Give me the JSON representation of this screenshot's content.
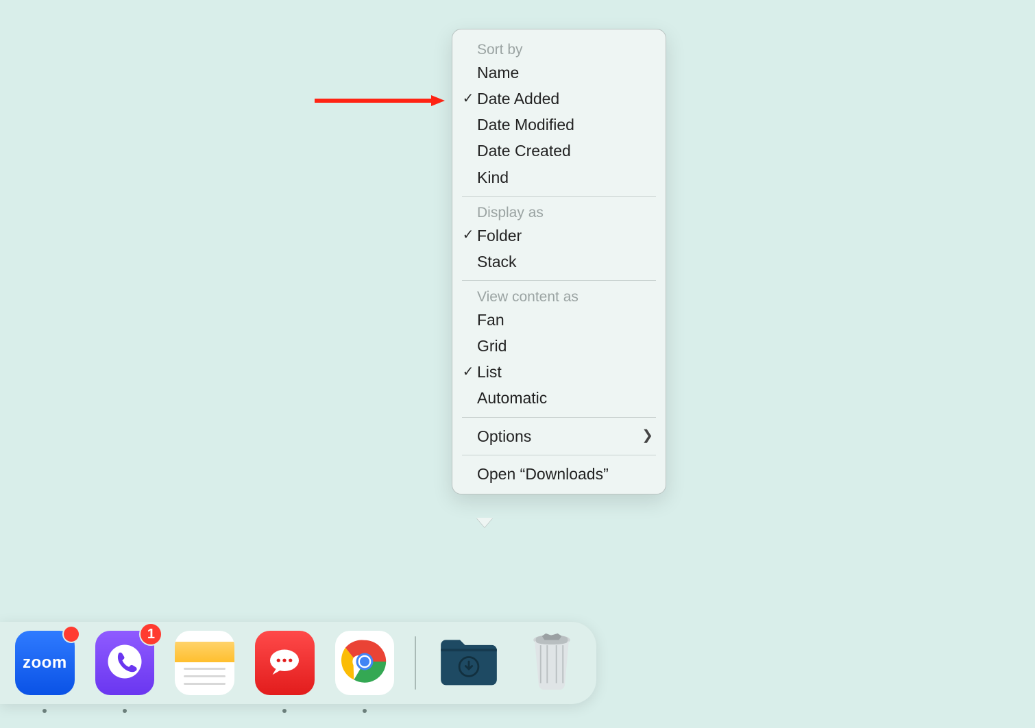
{
  "annotation": {
    "arrow_color": "#ff2414"
  },
  "menu": {
    "sort_by": {
      "label": "Sort by",
      "options": [
        "Name",
        "Date Added",
        "Date Modified",
        "Date Created",
        "Kind"
      ],
      "selected": "Date Added"
    },
    "display_as": {
      "label": "Display as",
      "options": [
        "Folder",
        "Stack"
      ],
      "selected": "Folder"
    },
    "view_as": {
      "label": "View content as",
      "options": [
        "Fan",
        "Grid",
        "List",
        "Automatic"
      ],
      "selected": "List"
    },
    "options_label": "Options",
    "open_label": "Open “Downloads”"
  },
  "dock": {
    "apps": [
      {
        "id": "zoom",
        "label": "zoom",
        "badge": "",
        "running": true
      },
      {
        "id": "viber",
        "label": "Viber",
        "badge": "1",
        "running": true
      },
      {
        "id": "notes",
        "label": "Notes",
        "badge": null,
        "running": true
      },
      {
        "id": "rocket",
        "label": "Rocket.Chat",
        "badge": null,
        "running": true
      },
      {
        "id": "chrome",
        "label": "Google Chrome",
        "badge": null,
        "running": true
      }
    ],
    "stacks": [
      {
        "id": "downloads",
        "label": "Downloads"
      },
      {
        "id": "trash",
        "label": "Trash"
      }
    ]
  }
}
